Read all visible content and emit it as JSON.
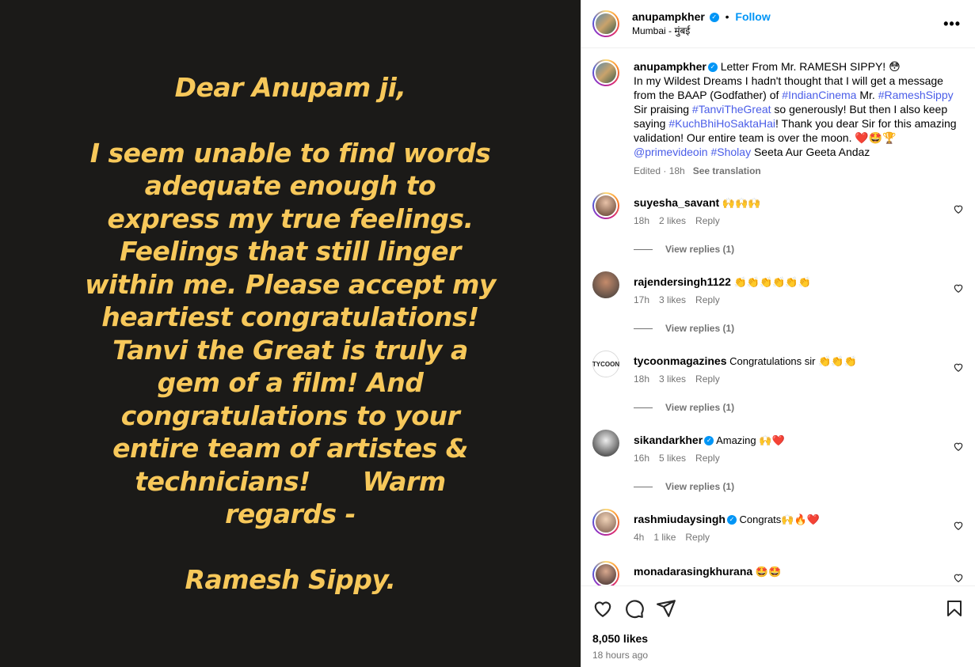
{
  "letter": {
    "greeting": "Dear Anupam ji,",
    "body": "I seem unable to find words adequate enough to express my true feelings. Feelings that still linger within me. Please accept my heartiest congratulations! Tanvi the Great is truly a gem of a film! And congratulations to your entire team of artistes & technicians!      Warm regards -",
    "signature": "Ramesh Sippy."
  },
  "header": {
    "username": "anupampkher",
    "dot": "•",
    "follow": "Follow",
    "location": "Mumbai - मुंबई",
    "more": "•••"
  },
  "caption": {
    "username": "anupampkher",
    "t1": " Letter From Mr. RAMESH SIPPY! 😳",
    "t2": "In my Wildest Dreams I hadn't thought that I will get a message from the BAAP (Godfather) of ",
    "tag1": "#IndianCinema",
    "t3": " Mr. ",
    "tag2": "#RameshSippy",
    "t4": " Sir praising ",
    "tag3": "#TanviTheGreat",
    "t5": " so generously! But then I also keep saying ",
    "tag4": "#KuchBhiHoSaktaHai",
    "t6": "! Thank you dear Sir for this amazing validation! Our entire team is over the moon. ❤️🤩🏆",
    "tag5": "@primevideoin",
    "t7": " ",
    "tag6": "#Sholay",
    "t8": " Seeta Aur Geeta Andaz",
    "edited": "Edited · 18h",
    "see_translation": "See translation"
  },
  "comments": [
    {
      "user": "suyesha_savant",
      "text": " 🙌🙌🙌",
      "time": "18h",
      "likes": "2 likes",
      "reply": "Reply",
      "view": "View replies (1)"
    },
    {
      "user": "rajendersingh1122",
      "text": " 👏👏👏👏👏👏",
      "time": "17h",
      "likes": "3 likes",
      "reply": "Reply",
      "view": "View replies (1)"
    },
    {
      "user": "tycoonmagazines",
      "text": " Congratulations sir 👏👏👏",
      "time": "18h",
      "likes": "3 likes",
      "reply": "Reply",
      "view": "View replies (1)",
      "avatar_text": "TYCOON"
    },
    {
      "user": "sikandarkher",
      "text": " Amazing 🙌❤️",
      "time": "16h",
      "likes": "5 likes",
      "reply": "Reply",
      "view": "View replies (1)"
    },
    {
      "user": "rashmiudaysingh",
      "text": " Congrats🙌🔥❤️",
      "time": "4h",
      "likes": "1 like",
      "reply": "Reply"
    },
    {
      "user": "monadarasingkhurana",
      "text": " 🤩🤩"
    }
  ],
  "footer": {
    "likes": "8,050 likes",
    "time": "18 hours ago"
  }
}
